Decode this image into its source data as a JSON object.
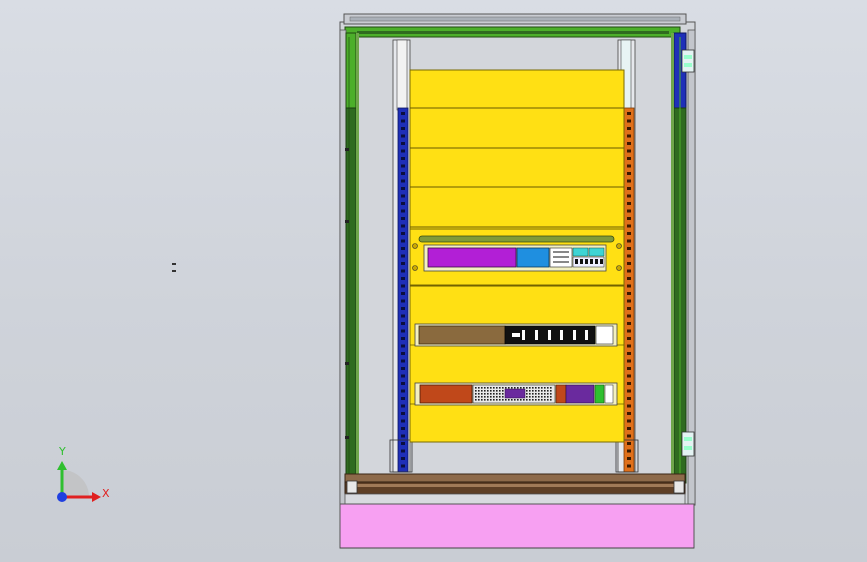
{
  "viewport": {
    "background_top": "#d9dde4",
    "background_bottom": "#c9cdd4"
  },
  "triad": {
    "y_label": "Y",
    "x_label": "X",
    "y_color": "#2fbf2f",
    "x_color": "#e02020",
    "z_color": "#1f3fe0"
  },
  "colors": {
    "frame_green_light": "#4caf2a",
    "frame_green_dark": "#2f6b1f",
    "frame_grey": "#b9bcc1",
    "rail_blue": "#1e2fb8",
    "rail_orange": "#e0701a",
    "panel_yellow": "#ffe014",
    "plinth_pink": "#f7a0f2",
    "base_brown": "#6b4a2e",
    "device_purple": "#b21fd6",
    "device_blue": "#1f8fe0",
    "device_brown": "#8a6a3e",
    "device_rust": "#c0481a",
    "device_violet": "#6a2a9e"
  }
}
